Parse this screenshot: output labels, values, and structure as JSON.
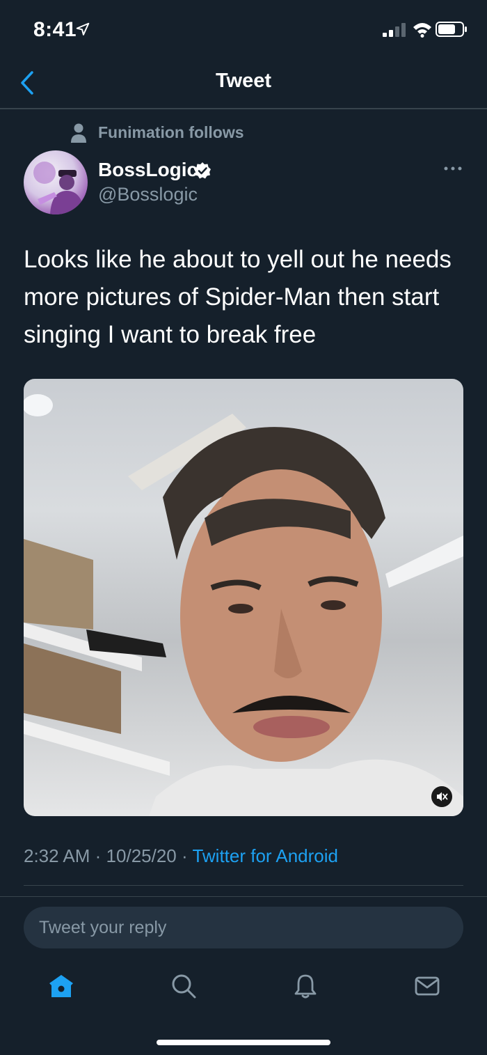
{
  "status_bar": {
    "time": "8:41",
    "icons": [
      "location-arrow-icon",
      "signal-icon",
      "wifi-icon",
      "battery-icon"
    ]
  },
  "header": {
    "title": "Tweet",
    "back_icon": "chevron-left-icon"
  },
  "social_context": {
    "icon": "person-icon",
    "text": "Funimation follows"
  },
  "author": {
    "display_name": "BossLogic",
    "verified": true,
    "handle": "@Bosslogic"
  },
  "tweet": {
    "text": "Looks like he about to yell out he needs more pictures of Spider-Man then start singing I want to break free",
    "media": {
      "type": "video",
      "muted": true,
      "mute_icon": "speaker-muted-icon"
    },
    "time": "2:32 AM",
    "date": "10/25/20",
    "separator": "·",
    "source": "Twitter for Android"
  },
  "reply": {
    "placeholder": "Tweet your reply"
  },
  "tab_bar": {
    "items": [
      "home-icon",
      "search-icon",
      "notifications-icon",
      "messages-icon"
    ],
    "active": "home-icon"
  },
  "colors": {
    "background": "#15202b",
    "accent": "#1da1f2",
    "secondary_text": "#8899a6",
    "divider": "#38444d",
    "input_background": "#253341"
  }
}
